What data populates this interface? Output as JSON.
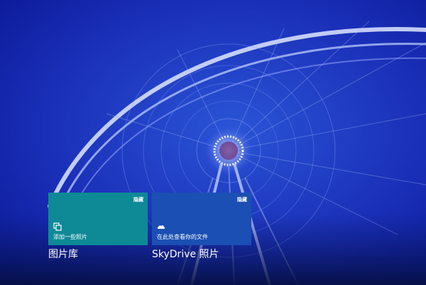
{
  "colors": {
    "pictures_tile": "#0d8a96",
    "skydrive_tile": "#1b4fb3"
  },
  "tiles": [
    {
      "hide_label": "隐藏",
      "icon": "add-photos-icon",
      "text": "添加一些照片",
      "title": "图片库"
    },
    {
      "hide_label": "隐藏",
      "icon": "skydrive-cloud-icon",
      "text": "在此处查看你的文件",
      "title": "SkyDrive 照片"
    }
  ]
}
